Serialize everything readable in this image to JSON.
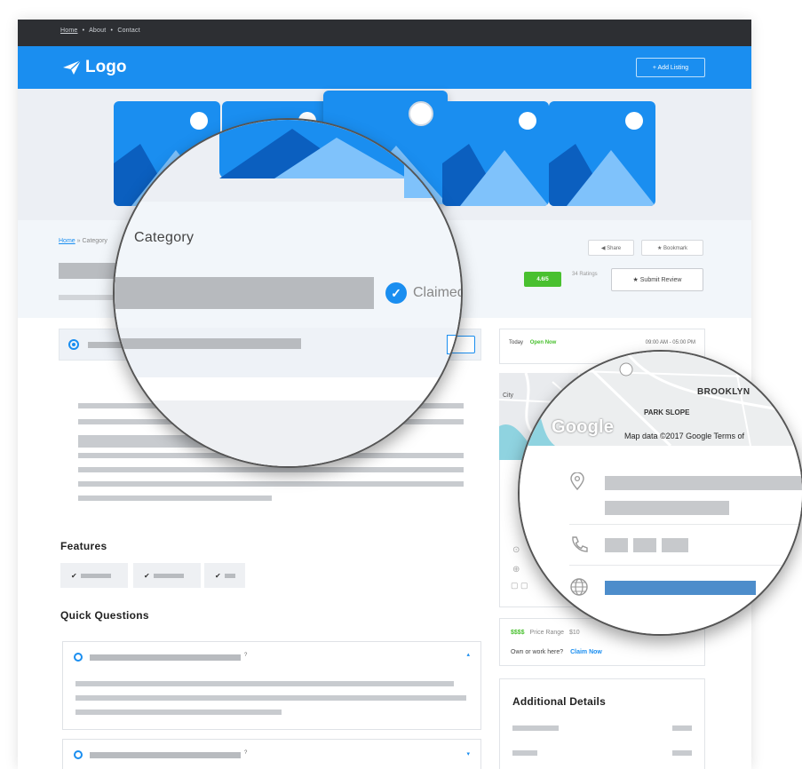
{
  "topnav": {
    "home": "Home",
    "sep1": "•",
    "about": "About",
    "sep2": "•",
    "contact": "Contact"
  },
  "header": {
    "logo": "Logo",
    "add_listing": "+ Add Listing"
  },
  "breadcrumb": {
    "home": "Home",
    "sep": "»",
    "category": "Category"
  },
  "actions": {
    "share": "◀ Share",
    "bookmark": "★ Bookmark"
  },
  "rating": {
    "score": "4.6/5",
    "count": "34 Ratings"
  },
  "review_button": "★ Submit Review",
  "sections": {
    "features": "Features",
    "quick_questions": "Quick Questions",
    "additional_details": "Additional Details"
  },
  "hours": {
    "today": "Today",
    "status": "Open Now",
    "range": "09:00 AM - 05:00 PM"
  },
  "map": {
    "city": "City",
    "brooklyn": "BROOKLYN",
    "park_slope": "PARK SLOPE",
    "google": "Google",
    "map_data": "Map data ©2017 Google   Terms of"
  },
  "price": {
    "symbol": "$$$$",
    "label": "Price Range",
    "value": "$10"
  },
  "claim": {
    "text": "Own or work here?",
    "link": "Claim Now"
  },
  "magnifier": {
    "category": "Category",
    "claimed": "Claimed"
  },
  "colors": {
    "brand": "#1a8ef0",
    "dark": "#2d2f33",
    "green": "#49c02f"
  }
}
